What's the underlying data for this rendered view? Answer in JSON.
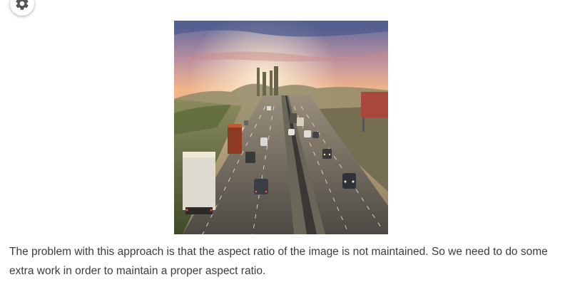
{
  "settings": {
    "icon": "gear-icon"
  },
  "article": {
    "image_subject": "highway-sunset-photo",
    "caption": "The problem with this approach is that the aspect ratio of the image is not maintained. So we need to do some extra work in order to maintain a proper aspect ratio."
  },
  "colors": {
    "text": "#3c3c3c",
    "background": "#ffffff"
  }
}
